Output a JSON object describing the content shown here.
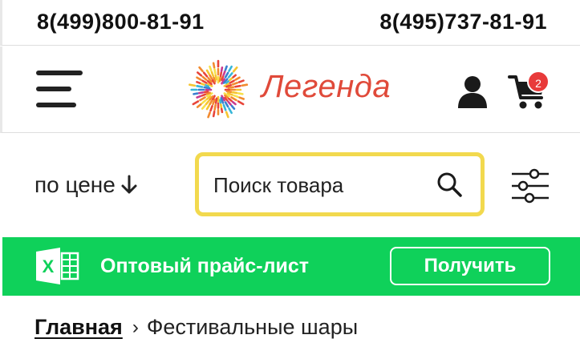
{
  "topbar": {
    "phone_left": "8(499)800-81-91",
    "phone_right": "8(495)737-81-91"
  },
  "header": {
    "logo_text": "Легенда",
    "cart_count": "2",
    "brand_color": "#e04a3a"
  },
  "toolbar": {
    "sort_label": "по цене",
    "search_placeholder": "Поиск товара",
    "search_border_color": "#f2d94e"
  },
  "promo": {
    "text": "Оптовый прайс-лист",
    "button_label": "Получить",
    "background": "#0fd15a"
  },
  "breadcrumb": {
    "home": "Главная",
    "separator": "›",
    "current": "Фестивальные шары"
  },
  "icons": {
    "menu": "hamburger-menu-icon",
    "user": "user-icon",
    "cart": "cart-icon",
    "search": "search-icon",
    "filter": "filter-sliders-icon",
    "excel": "excel-icon",
    "sort": "arrow-down-icon"
  }
}
